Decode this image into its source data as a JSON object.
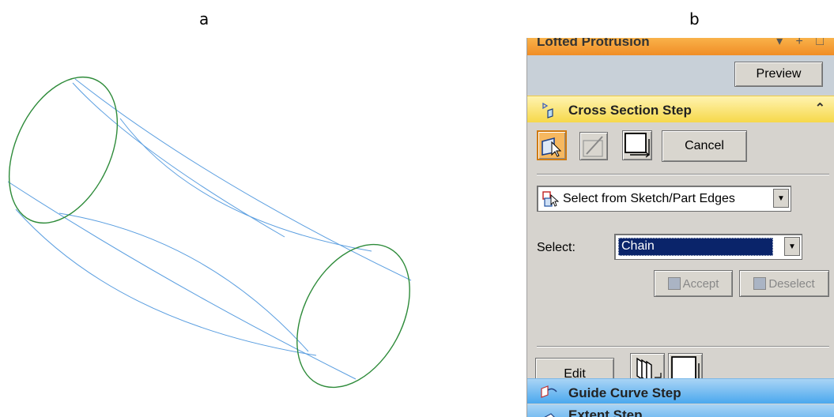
{
  "labels": {
    "a": "a",
    "b": "b"
  },
  "panel": {
    "title": "Lofted Protrusion",
    "title_controls": "▾ + □",
    "preview_label": "Preview",
    "cross_section_step": "Cross Section Step",
    "collapse_glyph": "⌃",
    "cancel_label": "Cancel",
    "select_mode_value": "Select from Sketch/Part Edges",
    "select_label": "Select:",
    "select_value": "Chain",
    "accept_label": "Accept",
    "deselect_label": "Deselect",
    "edit_label": "Edit",
    "guide_curve_step": "Guide Curve Step",
    "extent_step": "Extent Step"
  },
  "colors": {
    "section_ellipse": "#2e8b3a",
    "guide_curve": "#5a9ee0",
    "title_bar": "#f08d26",
    "step_active": "#f6d84a",
    "step_inactive": "#4aa8ee"
  },
  "icons": {
    "cross_section": "loft-section-icon",
    "select_tool": "select-cursor-icon",
    "sketch_tool": "sketch-pencil-icon",
    "plane_tool": "plane-icon",
    "mode_icon": "select-edges-icon",
    "multi_tool": "multi-section-icon",
    "guide_curve": "guide-curve-icon",
    "extent": "extent-icon"
  }
}
